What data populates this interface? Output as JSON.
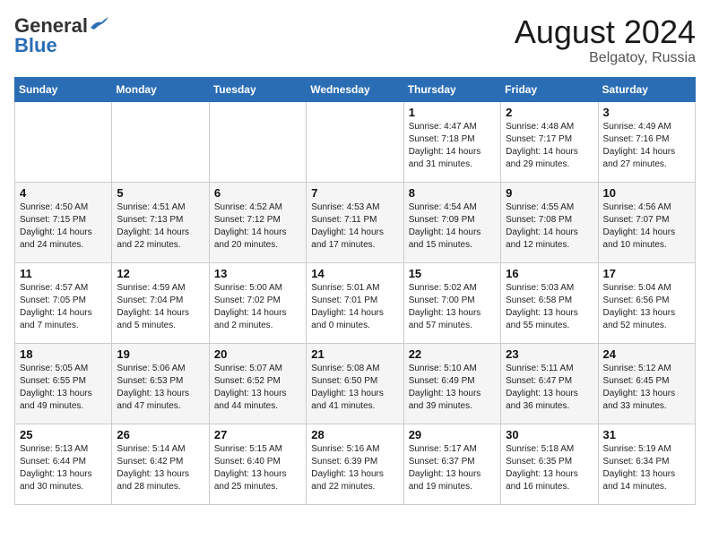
{
  "header": {
    "logo_general": "General",
    "logo_blue": "Blue",
    "month_title": "August 2024",
    "subtitle": "Belgatoy, Russia"
  },
  "days_of_week": [
    "Sunday",
    "Monday",
    "Tuesday",
    "Wednesday",
    "Thursday",
    "Friday",
    "Saturday"
  ],
  "weeks": [
    [
      {
        "day": "",
        "info": ""
      },
      {
        "day": "",
        "info": ""
      },
      {
        "day": "",
        "info": ""
      },
      {
        "day": "",
        "info": ""
      },
      {
        "day": "1",
        "info": "Sunrise: 4:47 AM\nSunset: 7:18 PM\nDaylight: 14 hours\nand 31 minutes."
      },
      {
        "day": "2",
        "info": "Sunrise: 4:48 AM\nSunset: 7:17 PM\nDaylight: 14 hours\nand 29 minutes."
      },
      {
        "day": "3",
        "info": "Sunrise: 4:49 AM\nSunset: 7:16 PM\nDaylight: 14 hours\nand 27 minutes."
      }
    ],
    [
      {
        "day": "4",
        "info": "Sunrise: 4:50 AM\nSunset: 7:15 PM\nDaylight: 14 hours\nand 24 minutes."
      },
      {
        "day": "5",
        "info": "Sunrise: 4:51 AM\nSunset: 7:13 PM\nDaylight: 14 hours\nand 22 minutes."
      },
      {
        "day": "6",
        "info": "Sunrise: 4:52 AM\nSunset: 7:12 PM\nDaylight: 14 hours\nand 20 minutes."
      },
      {
        "day": "7",
        "info": "Sunrise: 4:53 AM\nSunset: 7:11 PM\nDaylight: 14 hours\nand 17 minutes."
      },
      {
        "day": "8",
        "info": "Sunrise: 4:54 AM\nSunset: 7:09 PM\nDaylight: 14 hours\nand 15 minutes."
      },
      {
        "day": "9",
        "info": "Sunrise: 4:55 AM\nSunset: 7:08 PM\nDaylight: 14 hours\nand 12 minutes."
      },
      {
        "day": "10",
        "info": "Sunrise: 4:56 AM\nSunset: 7:07 PM\nDaylight: 14 hours\nand 10 minutes."
      }
    ],
    [
      {
        "day": "11",
        "info": "Sunrise: 4:57 AM\nSunset: 7:05 PM\nDaylight: 14 hours\nand 7 minutes."
      },
      {
        "day": "12",
        "info": "Sunrise: 4:59 AM\nSunset: 7:04 PM\nDaylight: 14 hours\nand 5 minutes."
      },
      {
        "day": "13",
        "info": "Sunrise: 5:00 AM\nSunset: 7:02 PM\nDaylight: 14 hours\nand 2 minutes."
      },
      {
        "day": "14",
        "info": "Sunrise: 5:01 AM\nSunset: 7:01 PM\nDaylight: 14 hours\nand 0 minutes."
      },
      {
        "day": "15",
        "info": "Sunrise: 5:02 AM\nSunset: 7:00 PM\nDaylight: 13 hours\nand 57 minutes."
      },
      {
        "day": "16",
        "info": "Sunrise: 5:03 AM\nSunset: 6:58 PM\nDaylight: 13 hours\nand 55 minutes."
      },
      {
        "day": "17",
        "info": "Sunrise: 5:04 AM\nSunset: 6:56 PM\nDaylight: 13 hours\nand 52 minutes."
      }
    ],
    [
      {
        "day": "18",
        "info": "Sunrise: 5:05 AM\nSunset: 6:55 PM\nDaylight: 13 hours\nand 49 minutes."
      },
      {
        "day": "19",
        "info": "Sunrise: 5:06 AM\nSunset: 6:53 PM\nDaylight: 13 hours\nand 47 minutes."
      },
      {
        "day": "20",
        "info": "Sunrise: 5:07 AM\nSunset: 6:52 PM\nDaylight: 13 hours\nand 44 minutes."
      },
      {
        "day": "21",
        "info": "Sunrise: 5:08 AM\nSunset: 6:50 PM\nDaylight: 13 hours\nand 41 minutes."
      },
      {
        "day": "22",
        "info": "Sunrise: 5:10 AM\nSunset: 6:49 PM\nDaylight: 13 hours\nand 39 minutes."
      },
      {
        "day": "23",
        "info": "Sunrise: 5:11 AM\nSunset: 6:47 PM\nDaylight: 13 hours\nand 36 minutes."
      },
      {
        "day": "24",
        "info": "Sunrise: 5:12 AM\nSunset: 6:45 PM\nDaylight: 13 hours\nand 33 minutes."
      }
    ],
    [
      {
        "day": "25",
        "info": "Sunrise: 5:13 AM\nSunset: 6:44 PM\nDaylight: 13 hours\nand 30 minutes."
      },
      {
        "day": "26",
        "info": "Sunrise: 5:14 AM\nSunset: 6:42 PM\nDaylight: 13 hours\nand 28 minutes."
      },
      {
        "day": "27",
        "info": "Sunrise: 5:15 AM\nSunset: 6:40 PM\nDaylight: 13 hours\nand 25 minutes."
      },
      {
        "day": "28",
        "info": "Sunrise: 5:16 AM\nSunset: 6:39 PM\nDaylight: 13 hours\nand 22 minutes."
      },
      {
        "day": "29",
        "info": "Sunrise: 5:17 AM\nSunset: 6:37 PM\nDaylight: 13 hours\nand 19 minutes."
      },
      {
        "day": "30",
        "info": "Sunrise: 5:18 AM\nSunset: 6:35 PM\nDaylight: 13 hours\nand 16 minutes."
      },
      {
        "day": "31",
        "info": "Sunrise: 5:19 AM\nSunset: 6:34 PM\nDaylight: 13 hours\nand 14 minutes."
      }
    ]
  ]
}
